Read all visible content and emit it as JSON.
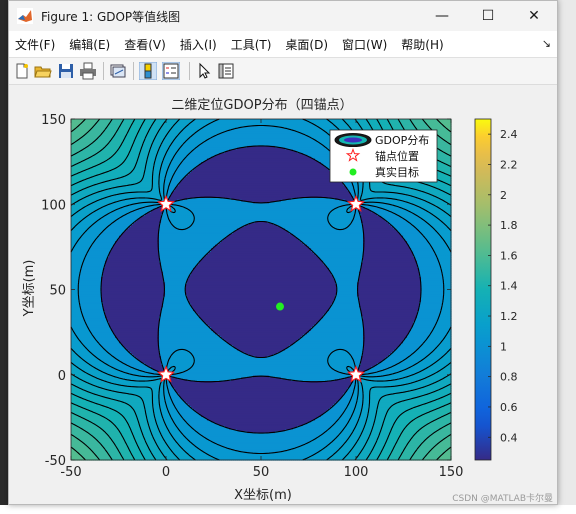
{
  "window": {
    "title": "Figure 1: GDOP等值线图",
    "controls": {
      "minimize": "—",
      "maximize": "☐",
      "close": "✕"
    }
  },
  "menu": {
    "items": [
      "文件(F)",
      "编辑(E)",
      "查看(V)",
      "插入(I)",
      "工具(T)",
      "桌面(D)",
      "窗口(W)",
      "帮助(H)"
    ],
    "overflow_arrow": "↘"
  },
  "toolbar": {
    "icons": [
      "new-figure-icon",
      "open-file-icon",
      "save-icon",
      "print-icon",
      "link-plot-icon",
      "insert-colorbar-icon",
      "insert-legend-icon",
      "pointer-icon",
      "property-inspector-icon"
    ]
  },
  "colors": {
    "low": "#3b30bd",
    "mid": "#14b5b0",
    "high": "#f8f91d",
    "anchor_marker": "#ff2020",
    "target_marker": "#22ee22"
  },
  "chart_data": {
    "type": "contour",
    "title": "二维定位GDOP分布（四锚点）",
    "xlabel": "X坐标(m)",
    "ylabel": "Y坐标(m)",
    "xlim": [
      -50,
      150
    ],
    "ylim": [
      -50,
      150
    ],
    "xticks": [
      -50,
      0,
      50,
      100,
      150
    ],
    "yticks": [
      -50,
      0,
      50,
      100,
      150
    ],
    "colorbar": {
      "ticks": [
        0.4,
        0.6,
        0.8,
        1,
        1.2,
        1.4,
        1.6,
        1.8,
        2,
        2.2,
        2.4
      ],
      "range": [
        0.25,
        2.5
      ]
    },
    "anchors": [
      {
        "x": 0,
        "y": 0
      },
      {
        "x": 100,
        "y": 0
      },
      {
        "x": 0,
        "y": 100
      },
      {
        "x": 100,
        "y": 100
      }
    ],
    "target": {
      "x": 60,
      "y": 40
    },
    "legend": {
      "position": "top-right",
      "entries": [
        "GDOP分布",
        "锚点位置",
        "真实目标"
      ]
    }
  },
  "watermark": "CSDN @MATLAB卡尔曼"
}
